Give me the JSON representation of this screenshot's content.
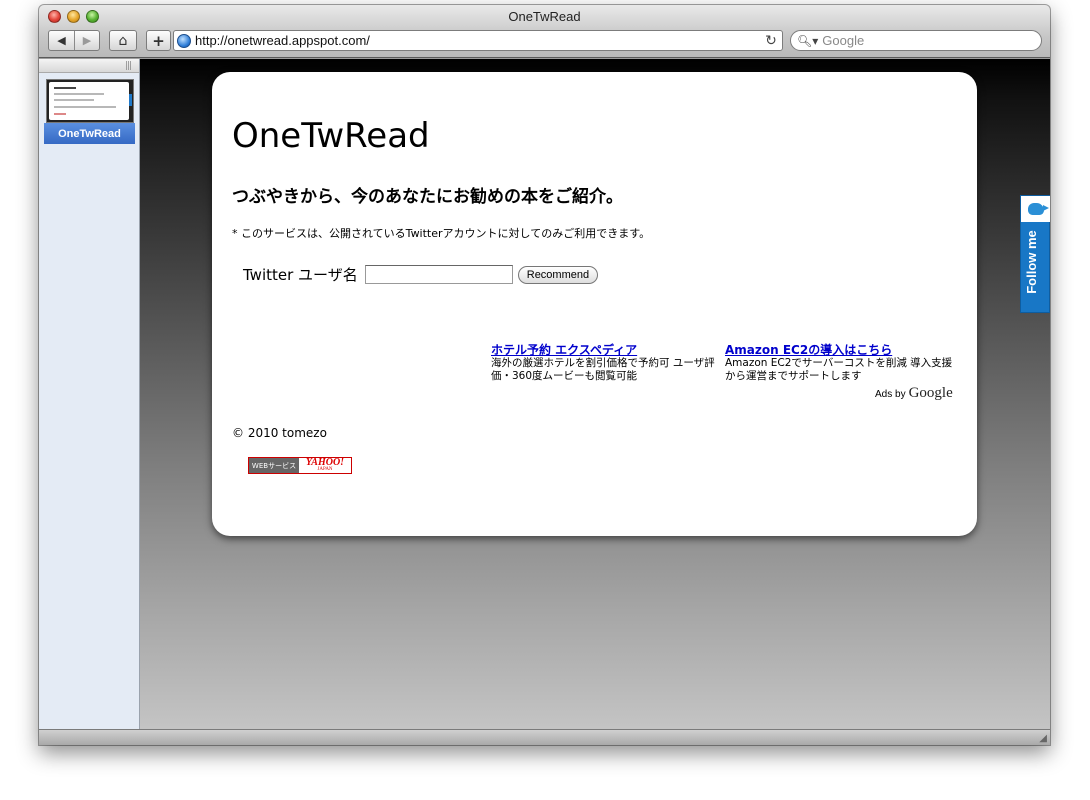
{
  "window": {
    "title": "OneTwRead"
  },
  "toolbar": {
    "back_glyph": "◀",
    "forward_glyph": "▶",
    "home_glyph": "⌂",
    "add_glyph": "+",
    "url": "http://onetwread.appspot.com/",
    "reload_glyph": "↻",
    "search_placeholder": "Google",
    "search_glyph": "🔍︎▾"
  },
  "sidebar": {
    "grip_glyph": "|||",
    "bookmark_label": "OneTwRead"
  },
  "page": {
    "site_title": "OneTwRead",
    "tagline": "つぶやきから、今のあなたにお勧めの本をご紹介。",
    "notice": "* このサービスは、公開されているTwitterアカウントに対してのみご利用できます。",
    "form": {
      "label": "Twitter ユーザ名",
      "input_value": "",
      "button_label": "Recommend"
    },
    "ads": [
      {
        "title": "ホテル予約 エクスペディア",
        "body": "海外の厳選ホテルを割引価格で予約可 ユーザ評価・360度ムービーも閲覧可能"
      },
      {
        "title": "Amazon EC2の導入はこちら",
        "body": "Amazon EC2でサーバーコストを削減 導入支援から運営までサポートします"
      }
    ],
    "ads_by": "Ads by",
    "ads_logo": "Google",
    "copyright": "© 2010 tomezo",
    "badge": {
      "left": "WEBサービス",
      "right": "YAHOO!",
      "sub": "JAPAN"
    }
  },
  "follow_tab": {
    "label": "Follow me"
  },
  "status": {
    "resize_glyph": "◢"
  },
  "colors": {
    "accent": "#1877c6",
    "link": "#0000cc",
    "sidebar_bg": "#e4ebf5"
  }
}
